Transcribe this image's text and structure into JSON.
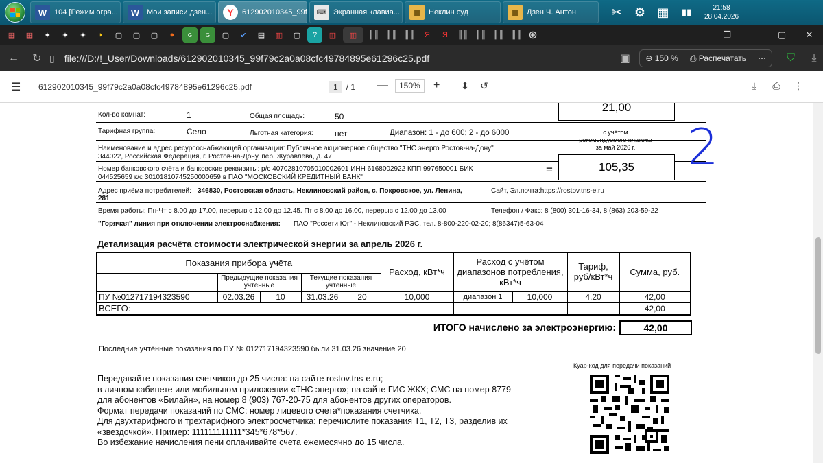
{
  "taskbar": {
    "tasks": [
      {
        "icon": "W",
        "label": "104 [Режим огра..."
      },
      {
        "icon": "W",
        "label": "Мои записи дзен..."
      },
      {
        "icon": "Y",
        "label": "612902010345_99f..."
      },
      {
        "icon": "⌨",
        "label": "Экранная клавиа..."
      },
      {
        "icon": "▆",
        "label": "Неклин суд"
      },
      {
        "icon": "▆",
        "label": "Дзен Ч. Антон"
      }
    ],
    "clock_time": "21:58",
    "clock_date": "28.04.2026"
  },
  "browser": {
    "url": "file:///D:/!_User/Downloads/612902010345_99f79c2a0a08cfc49784895e61296c25.pdf",
    "zoom": "150 %",
    "print_label": "Распечатать"
  },
  "pdf_toolbar": {
    "filename": "612902010345_99f79c2a0a08cfc49784895e61296c25.pdf",
    "page_current": "1",
    "page_total": "/ 1",
    "zoom": "150%"
  },
  "doc": {
    "rooms_label": "Кол-во комнат:",
    "rooms_value": "1",
    "area_label": "Общая площадь:",
    "area_value": "50",
    "tariff_group_label": "Тарифная группа:",
    "tariff_group_value": "Село",
    "benefit_label": "Льготная категория:",
    "benefit_value": "нет",
    "range_text": "Диапазон: 1 - до 600; 2 - до 6000",
    "org_line1": "Наименование и адрес ресурсоснабжающей организации: Публичное акционерное общество \"ТНС энерго Ростов-на-Дону\"",
    "org_line2": "344022, Российская Федерация, г. Ростов-на-Дону, пер. Журавлева, д. 47",
    "bank_line1": "Номер банковского счёта и банковские реквизиты: р/с 40702810705010002601 ИНН 6168002922 КПП 997650001 БИК",
    "bank_line2": "044525659 к/с 30101810745250000659 в ПАО \"МОСКОВСКИЙ КРЕДИТНЫЙ БАНК\"",
    "address_prefix": "Адрес приёма потребителей:",
    "address_bold": "346830, Ростовская область, Неклиновский район, с. Покровское, ул. Ленина,",
    "address_bold2": "281",
    "site": "Сайт, Эл.почта:https://rostov.tns-e.ru",
    "hours": "Время работы: Пн-Чт с 8.00 до 17.00, перерыв с 12.00 до 12.45. Пт с 8.00 до 16.00, перерыв с 12.00 до 13.00",
    "phone": "Телефон / Факс: 8 (800) 301-16-34, 8 (863) 203-59-22",
    "hotline_bold": "\"Горячая\" линия при отключении электроснабжения:",
    "hotline_rest": "ПАО \"Россети Юг\" - Неклиновский РЭС, тел. 8-800-220-02-20; 8(86347)5-63-04",
    "amount_top": "21,00",
    "note_line1": "с учётом",
    "note_line2": "рекомендуемого платежа",
    "note_line3": "за май 2026 г.",
    "eq": "=",
    "amount_total": "105,35",
    "handwritten_mark": "2"
  },
  "detail": {
    "title": "Детализация расчёта стоимости электрической энергии за апрель 2026 г.",
    "h_meter": "Показания прибора учёта",
    "h_prev": "Предыдущие показания учтённые",
    "h_curr": "Текущие показания учтённые",
    "h_consumption": "Расход, кВт*ч",
    "h_consumption_range": "Расход с учётом диапазонов потребления, кВт*ч",
    "h_tariff": "Тариф, руб/кВт*ч",
    "h_sum": "Сумма, руб.",
    "row": {
      "meter": "ПУ №012717194323590",
      "prev_date": "02.03.26",
      "prev_val": "10",
      "curr_date": "31.03.26",
      "curr_val": "20",
      "consumption": "10,000",
      "range": "диапазон 1",
      "range_val": "10,000",
      "tariff": "4,20",
      "sum": "42,00"
    },
    "total_label": "ВСЕГО:",
    "total_sum": "42,00",
    "itogo_label": "ИТОГО начислено за электроэнергию:",
    "itogo_value": "42,00"
  },
  "footer": {
    "last_reading": "Последние учтённые показания по ПУ № 012717194323590 были 31.03.26 значение 20",
    "qr_caption": "Куар-код для передачи показаний",
    "lines": [
      "Передавайте показания счетчиков до 25 числа: на сайте rostov.tns-e.ru;",
      "в личном кабинете или мобильном приложении «ТНС энерго»; на сайте ГИС ЖКХ; СМС на номер 8779",
      "для абонентов «Билайн», на номер 8 (903) 767-20-75 для абонентов других операторов.",
      "Формат передачи показаний по СМС: номер лицевого счета*показания счетчика.",
      "Для двухтарифного и трехтарифного электросчетчика: перечислите показания Т1, Т2, Т3, разделив их",
      "«звездочкой». Пример: 111111111111*345*678*567.",
      "Во избежание начисления пени оплачивайте счета ежемесячно до 15 числа."
    ]
  }
}
